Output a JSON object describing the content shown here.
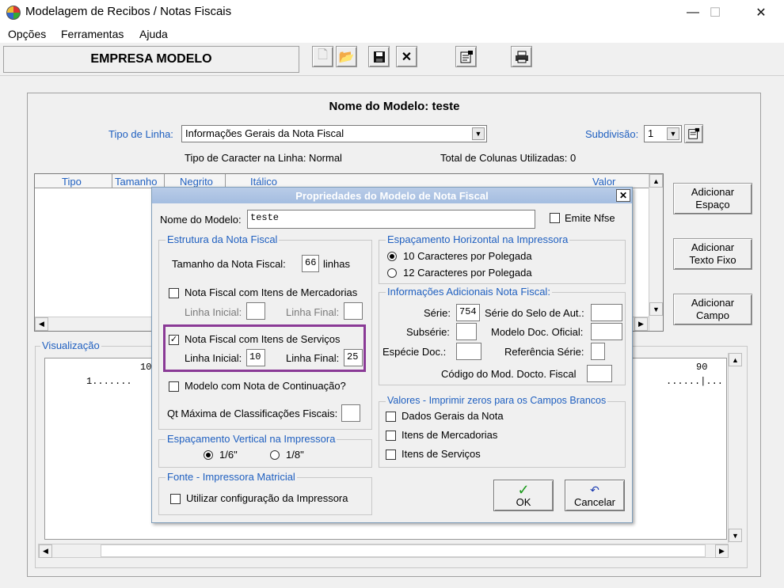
{
  "window": {
    "title": "Modelagem de Recibos / Notas Fiscais",
    "minimize": "—",
    "maximize": "☐",
    "close": "✕"
  },
  "menu": [
    "Opções",
    "Ferramentas",
    "Ajuda"
  ],
  "toolbar": {
    "company": "EMPRESA MODELO"
  },
  "main": {
    "model_name_title": "Nome do Modelo: teste",
    "line_type_label": "Tipo de Linha:",
    "line_type_value": "Informações Gerais da Nota Fiscal",
    "subdivision_label": "Subdivisão:",
    "subdivision_value": "1",
    "char_type": "Tipo de Caracter na Linha: Normal",
    "total_columns": "Total de Colunas Utilizadas: 0",
    "grid_columns": [
      "Tipo",
      "Tamanho",
      "Negrito",
      "Itálico",
      "Valor"
    ],
    "side_buttons": [
      "Adicionar\nEspaço",
      "Adicionar\nTexto Fixo",
      "Adicionar\nCampo"
    ],
    "viz_legend": "Visualização",
    "ruler_top_left": "10",
    "ruler_top_right": "90",
    "ruler_bottom_left": "1.......",
    "ruler_bottom_right": "......|..."
  },
  "dialog": {
    "title": "Propriedades do Modelo de Nota Fiscal",
    "close": "✕",
    "model_name_label": "Nome do Modelo:",
    "model_name_value": "teste",
    "emite_nfse": "Emite Nfse",
    "estrutura": {
      "legend": "Estrutura da Nota Fiscal",
      "size_label": "Tamanho da Nota Fiscal:",
      "size_value": "66",
      "size_unit": "linhas",
      "merc_label": "Nota Fiscal com Itens de Mercadorias",
      "merc_initial": "Linha Inicial:",
      "merc_final": "Linha Final:",
      "serv_label": "Nota Fiscal com Itens de Serviços",
      "serv_initial": "Linha Inicial:",
      "serv_initial_value": "10",
      "serv_final": "Linha Final:",
      "serv_final_value": "25",
      "continuation": "Modelo com Nota de Continuação?",
      "max_class": "Qt Máxima de Classificações Fiscais:"
    },
    "vertical": {
      "legend": "Espaçamento Vertical na Impressora",
      "opt1": "1/6\"",
      "opt2": "1/8\""
    },
    "fonte": {
      "legend": "Fonte - Impressora Matricial",
      "option": "Utilizar configuração da Impressora"
    },
    "horizontal": {
      "legend": "Espaçamento Horizontal na Impressora",
      "opt1": "10 Caracteres por Polegada",
      "opt2": "12 Caracteres por Polegada"
    },
    "adicionais": {
      "legend": "Informações Adicionais Nota Fiscal:",
      "serie": "Série:",
      "serie_value": "754",
      "selo": "Série do Selo de Aut.:",
      "subserie": "Subsérie:",
      "modelo_doc": "Modelo Doc. Oficial:",
      "especie": "Espécie Doc.:",
      "ref_serie": "Referência Série:",
      "codigo": "Código do Mod. Docto. Fiscal"
    },
    "zeros": {
      "legend": "Valores - Imprimir zeros para os Campos Brancos",
      "opt1": "Dados Gerais da Nota",
      "opt2": "Itens de Mercadorias",
      "opt3": "Itens de Serviços"
    },
    "ok": "OK",
    "cancel": "Cancelar",
    "highlight_color": "#8a3a96"
  }
}
